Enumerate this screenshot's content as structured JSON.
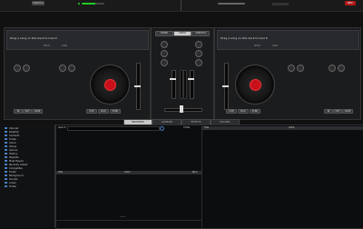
{
  "header": {
    "logo": "Options",
    "rec": "REC"
  },
  "deck_left": {
    "prompt": "Drag a song on this deck to load it",
    "pitch_label": "PITCH",
    "gain_label": "GAIN",
    "buttons": [
      "CUE",
      "PLAY",
      "SYNC",
      "IN",
      "OUT",
      "LOOP"
    ]
  },
  "deck_right": {
    "prompt": "Drag a song on this deck to load it",
    "pitch_label": "PITCH",
    "gain_label": "GAIN",
    "buttons": [
      "CUE",
      "PLAY",
      "SYNC",
      "IN",
      "OUT",
      "LOOP"
    ]
  },
  "mixer": {
    "mode_tabs": [
      "MIXER",
      "VIDEO",
      "SCRATCH"
    ],
    "active_mode": "VIDEO"
  },
  "browser_tabs": [
    "BROWSER",
    "SAMPLER",
    "EFFECTS",
    "RECORD"
  ],
  "active_browser_tab": "BROWSER",
  "sidebar": {
    "items": [
      "Internet",
      "Desktop",
      "Contacts",
      "Folder",
      "Cloud",
      "iTunes",
      "Genres",
      "History",
      "Playlists",
      "Most Played",
      "Recently Added",
      "Compatible",
      "Folder",
      "Background",
      "Sounds",
      "Loops",
      "Folder"
    ]
  },
  "search": {
    "label": "Search:",
    "files_count": "0 files"
  },
  "columns": {
    "title": "Title",
    "artist": "Artist",
    "bpm": "Bpm"
  },
  "sidelist": {
    "empty_label": "sidelist"
  },
  "colors": {
    "accent_red": "#c8101c",
    "accent_blue": "#4a7fc1",
    "background": "#111111"
  }
}
